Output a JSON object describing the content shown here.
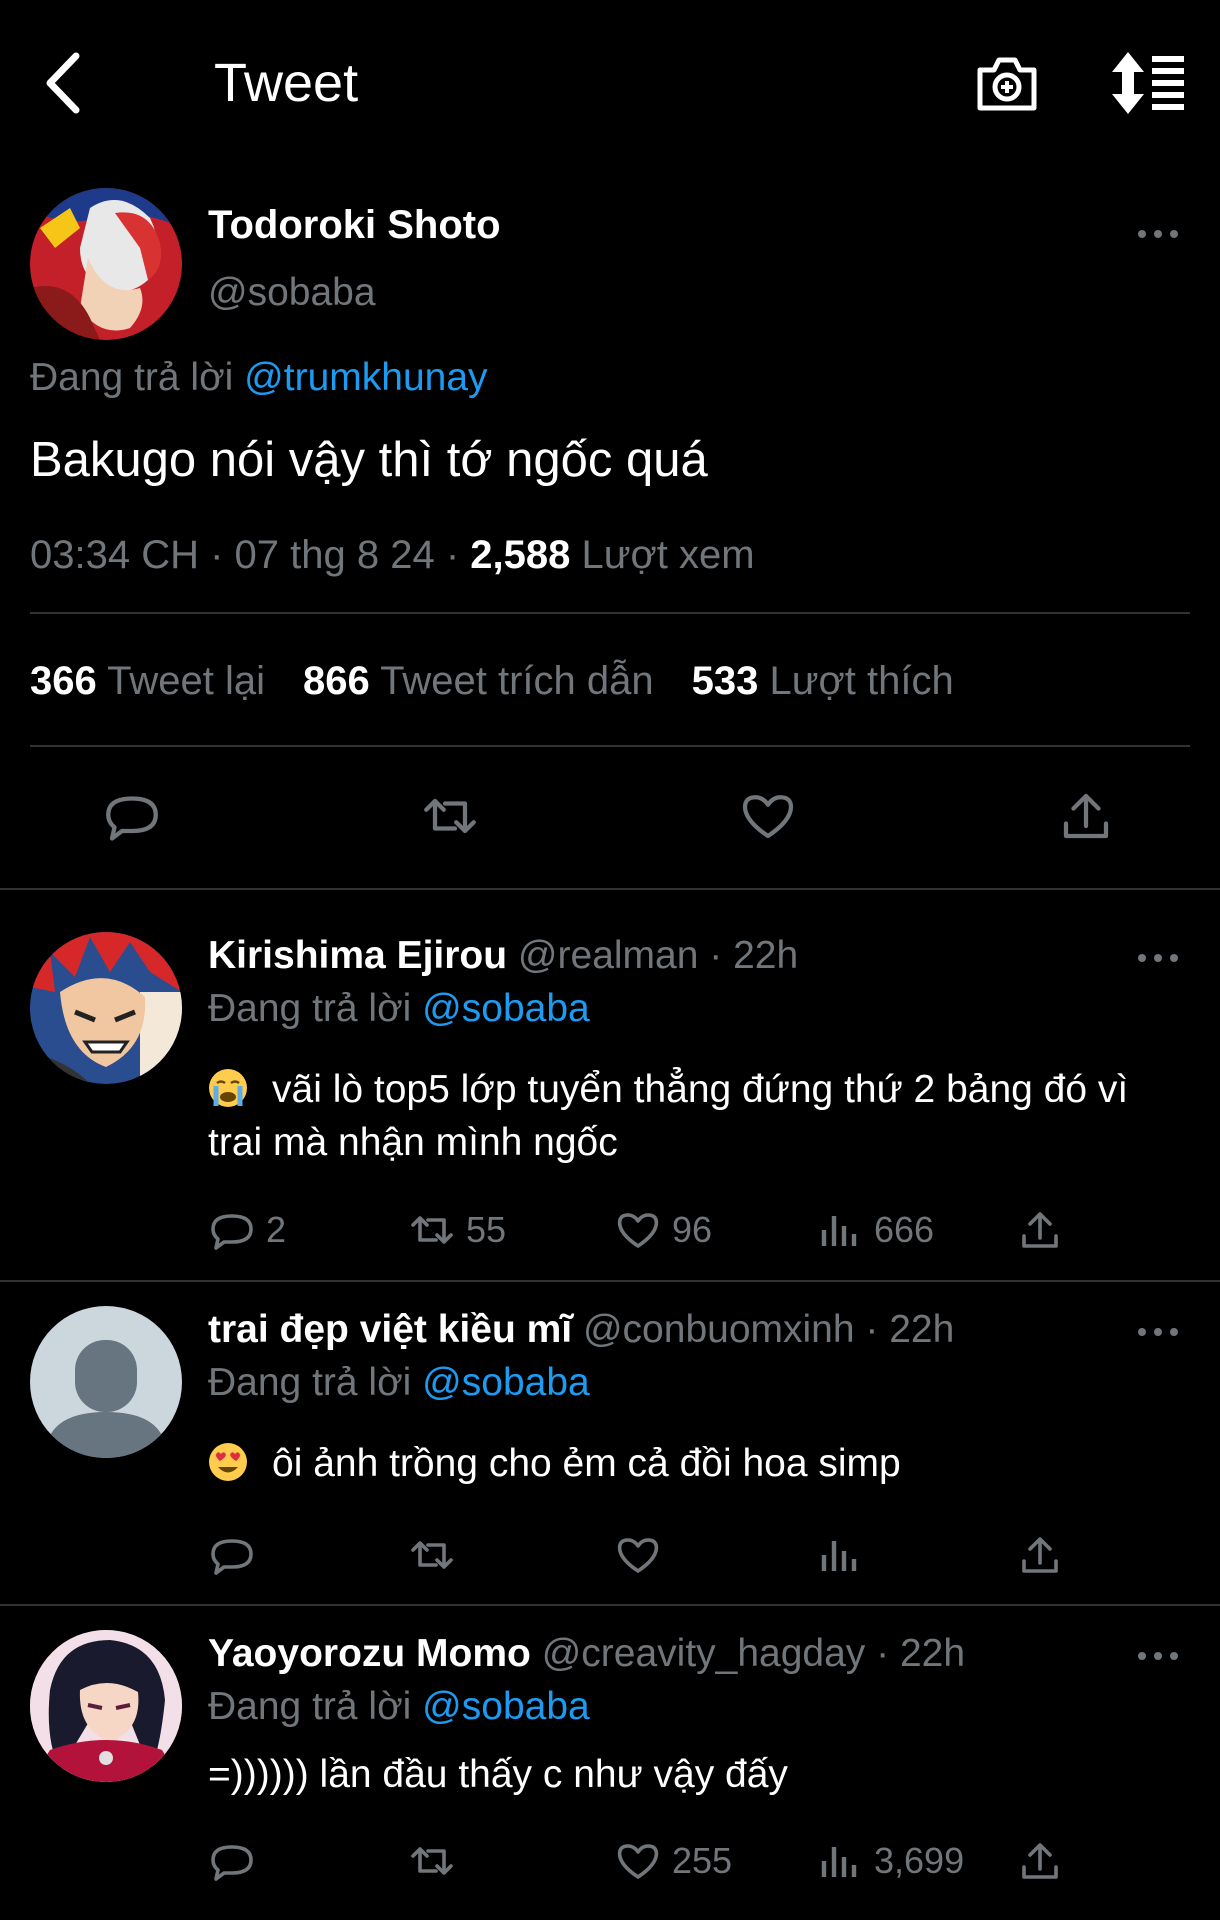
{
  "header": {
    "title": "Tweet"
  },
  "tweet": {
    "name": "Todoroki Shoto",
    "handle": "@sobaba",
    "reply_prefix": "Đang trả lời",
    "reply_to": "@trumkhunay",
    "text": "Bakugo nói vậy thì tớ ngốc quá",
    "time": "03:34 CH · 07 thg 8 24 · ",
    "views": "2,588",
    "views_label": "Lượt xem",
    "retweets": "366",
    "retweets_label": "Tweet lại",
    "quotes": "866",
    "quotes_label": "Tweet trích dẫn",
    "likes": "533",
    "likes_label": "Lượt thích"
  },
  "replies": [
    {
      "name": "Kirishima Ejirou",
      "handle": "@realman",
      "time": "· 22h",
      "reply_prefix": "Đang trả lời",
      "reply_to": "@sobaba",
      "emoji": "crying-face",
      "text": "vãi lò top5 lớp tuyển thẳng đứng thứ 2 bảng đó vì trai mà nhận mình ngốc",
      "replies": "2",
      "retweets": "55",
      "likes": "96",
      "views": "666"
    },
    {
      "name": "trai đẹp việt kiều mĩ",
      "handle": "@conbuomxinh",
      "time": "· 22h",
      "reply_prefix": "Đang trả lời",
      "reply_to": "@sobaba",
      "emoji": "heart-eyes",
      "text": "ôi ảnh trồng cho ẻm cả đồi hoa simp",
      "replies": "",
      "retweets": "",
      "likes": "",
      "views": ""
    },
    {
      "name": "Yaoyorozu Momo",
      "handle": "@creavity_hagday",
      "time": "· 22h",
      "reply_prefix": "Đang trả lời",
      "reply_to": "@sobaba",
      "text": "=)))))) lần đầu thấy c như vậy đấy",
      "replies": "",
      "retweets": "",
      "likes": "255",
      "views": "3,699"
    }
  ],
  "colors": {
    "background": "#000000",
    "link": "#1d9bf0",
    "muted": "#71767b"
  }
}
